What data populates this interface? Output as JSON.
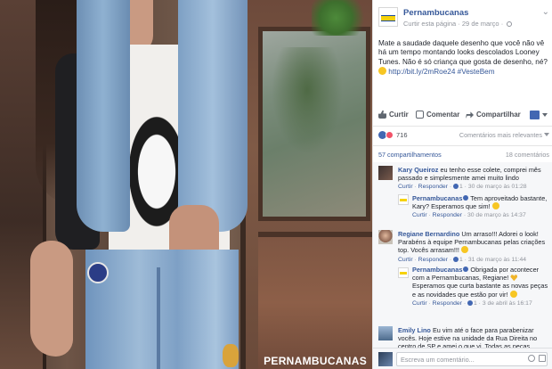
{
  "photo": {
    "watermark": "PERNAMBUCANAS"
  },
  "post": {
    "page_name": "Pernambucanas",
    "like_page": "Curtir esta página",
    "date": "29 de março",
    "text_main": "Mate a saudade daquele desenho que você não vê há um tempo montando looks descolados Looney Tunes. Não é só criança que gosta de desenho, né?",
    "link": "http://bit.ly/2mRoe24",
    "hashtag": "#VesteBem",
    "menu_icon": "chevron-down-icon"
  },
  "actions": {
    "like": "Curtir",
    "comment": "Comentar",
    "share": "Compartilhar"
  },
  "reactions": {
    "count": "716",
    "sort_label": "Comentários mais relevantes"
  },
  "stats": {
    "shares": "57 compartilhamentos",
    "comments": "18 comentários"
  },
  "comments": [
    {
      "name": "Kary Queiroz",
      "text": "eu tenho esse colete, comprei mês passado e simplesmente amei muito lindo",
      "reply": "Responder",
      "like": "Curtir",
      "likes": "1",
      "time": "30 de março às 01:28"
    },
    {
      "name": "Pernambucanas",
      "text": "Tem aproveitado bastante, Kary? Esperamos que sim!",
      "reply": "Responder",
      "like": "Curtir",
      "time": "30 de março às 14:37"
    },
    {
      "name": "Regiane Bernardino",
      "text": "Um arraso!!! Adorei o look! Parabéns à equipe Pernambucanas pelas criações top. Vocês arrasam!!!",
      "reply": "Responder",
      "like": "Curtir",
      "likes": "1",
      "time": "31 de março às 11:44"
    },
    {
      "name": "Pernambucanas",
      "text1": "Obrigada por acontecer com a Pernambucanas, Regiane!",
      "text2": "Esperamos que curta bastante as novas peças e as novidades que estão por vir!",
      "reply": "Responder",
      "like": "Curtir",
      "likes": "1",
      "time": "3 de abril às 16:17"
    },
    {
      "name": "Emily Lino",
      "text": "Eu vim até o face para parabenizar vocês. Hoje estive na unidade da Rua Direita no centro de SP e amei o que vi. Todas as peças"
    }
  ],
  "composer": {
    "placeholder": "Escreva um comentário..."
  }
}
